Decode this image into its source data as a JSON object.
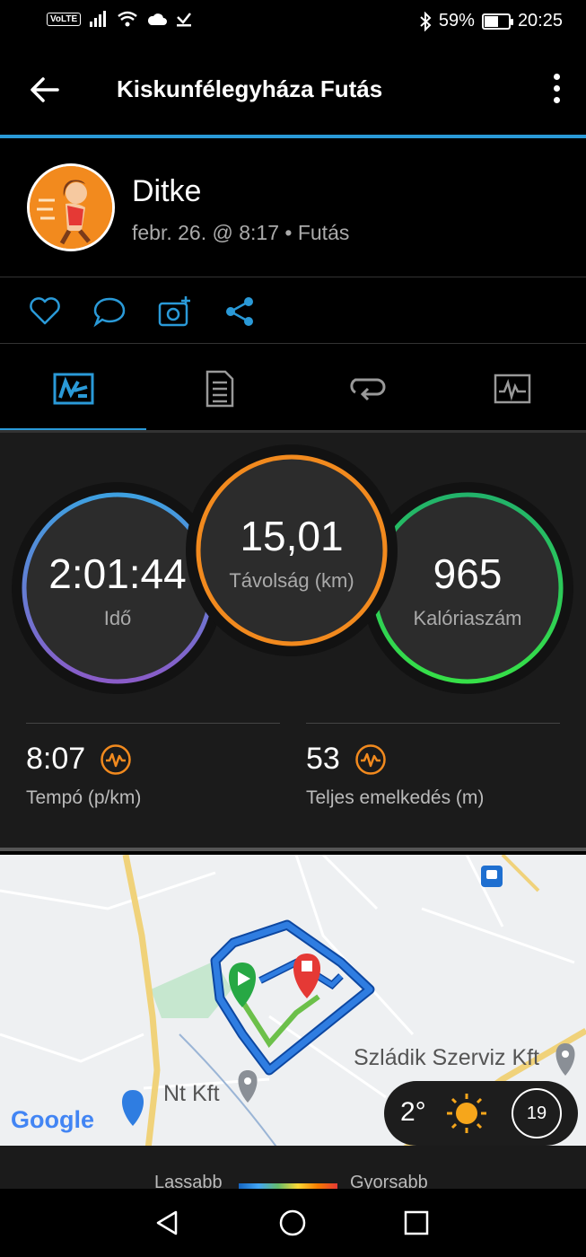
{
  "status_bar": {
    "volte": "VoLTE",
    "battery_percent": "59%",
    "battery_level": 0.59,
    "time": "20:25",
    "icons": [
      "signal-icon",
      "wifi-icon",
      "cloud-icon",
      "download-icon",
      "bluetooth-icon",
      "battery-icon"
    ]
  },
  "app_bar": {
    "title": "Kiskunfélegyháza Futás",
    "icons": [
      "back-arrow-icon",
      "more-vert-icon"
    ]
  },
  "profile": {
    "name": "Ditke",
    "meta": "febr. 26. @ 8:17 • Futás"
  },
  "actions": [
    "like-heart-icon",
    "comment-icon",
    "add-photo-icon",
    "share-icon"
  ],
  "tabs": [
    {
      "icon": "map-overview-icon",
      "selected": true
    },
    {
      "icon": "details-list-icon",
      "selected": false
    },
    {
      "icon": "laps-loop-icon",
      "selected": false
    },
    {
      "icon": "charts-icon",
      "selected": false
    }
  ],
  "stats": {
    "time": {
      "value": "2:01:44",
      "label": "Idő"
    },
    "distance": {
      "value": "15,01",
      "label": "Távolság (km)"
    },
    "calories": {
      "value": "965",
      "label": "Kalóriaszám"
    },
    "pace": {
      "value": "8:07",
      "label": "Tempó (p/km)"
    },
    "elevation": {
      "value": "53",
      "label": "Teljes emelkedés (m)"
    }
  },
  "colors": {
    "accent": "#2a9ad8",
    "time_ring": [
      "#3ea0e0",
      "#8a5cc8"
    ],
    "distance_ring": "#f28a1e",
    "calories_ring": [
      "#22b36a",
      "#36e048"
    ],
    "route": "#2f7de1",
    "route_segment": "#6cc04a"
  },
  "map": {
    "labels": {
      "business": "Szládik Szerviz Kft",
      "place": "Nt Kft",
      "logo": "Google"
    },
    "weather": {
      "temperature": "2°",
      "wind": "19"
    }
  },
  "legend": {
    "slower": "Lassabb",
    "faster": "Gyorsabb"
  },
  "nav": [
    "back-triangle-icon",
    "home-circle-icon",
    "recents-square-icon"
  ]
}
